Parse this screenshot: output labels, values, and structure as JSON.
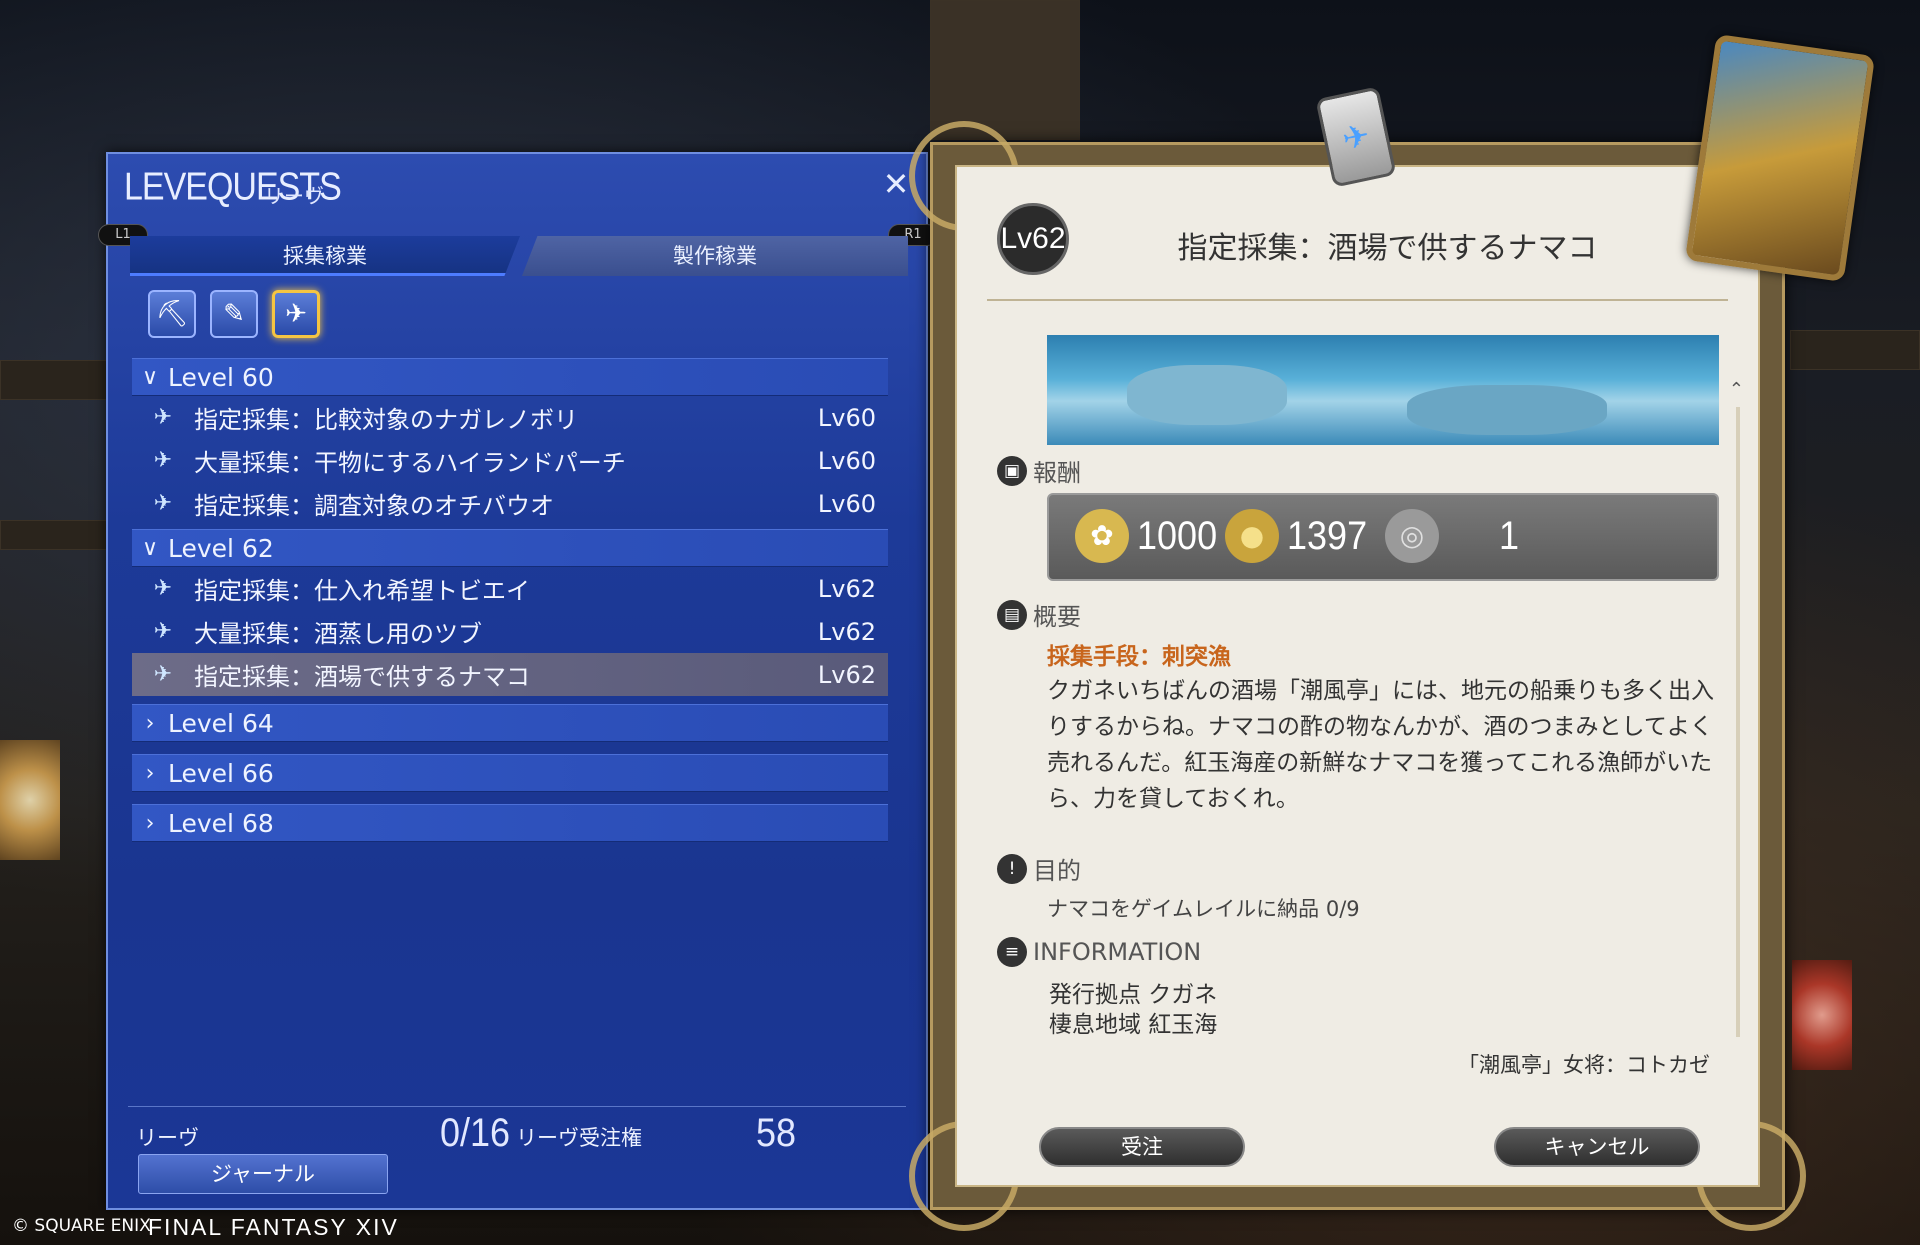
{
  "window": {
    "title": "LEVEQUESTS",
    "subtitle": "リーヴ",
    "close_icon": "close-icon",
    "pad_left": "L1",
    "pad_right": "R1"
  },
  "tabs": [
    {
      "label": "採集稼業",
      "active": true
    },
    {
      "label": "製作稼業",
      "active": false
    }
  ],
  "class_icons": [
    {
      "name": "pickaxe-icon",
      "glyph": "⛏",
      "selected": false
    },
    {
      "name": "sickle-icon",
      "glyph": "✎",
      "selected": false
    },
    {
      "name": "fish-icon",
      "glyph": "✈",
      "selected": true
    }
  ],
  "groups": [
    {
      "label": "Level 60",
      "expanded": true,
      "items": [
        {
          "name": "指定採集：比較対象のナガレノボリ",
          "level": "Lv60",
          "selected": false
        },
        {
          "name": "大量採集：干物にするハイランドパーチ",
          "level": "Lv60",
          "selected": false
        },
        {
          "name": "指定採集：調査対象のオチバウオ",
          "level": "Lv60",
          "selected": false
        }
      ]
    },
    {
      "label": "Level 62",
      "expanded": true,
      "items": [
        {
          "name": "指定採集：仕入れ希望トビエイ",
          "level": "Lv62",
          "selected": false
        },
        {
          "name": "大量採集：酒蒸し用のツブ",
          "level": "Lv62",
          "selected": false
        },
        {
          "name": "指定採集：酒場で供するナマコ",
          "level": "Lv62",
          "selected": true
        }
      ]
    },
    {
      "label": "Level 64",
      "expanded": false,
      "items": []
    },
    {
      "label": "Level 66",
      "expanded": false,
      "items": []
    },
    {
      "label": "Level 68",
      "expanded": false,
      "items": []
    }
  ],
  "footer": {
    "leve_label": "リーヴ",
    "leve_count": "0/16",
    "allowance_label": "リーヴ受注権",
    "allowance_value": "58",
    "journal_button": "ジャーナル"
  },
  "detail": {
    "level_badge": "Lv62",
    "title": "指定採集：酒場で供するナマコ",
    "reward_heading": "報酬",
    "rewards": [
      {
        "icon": "exp-icon",
        "glyph": "✿",
        "value": "1000",
        "color": "#d8b850"
      },
      {
        "icon": "gil-icon",
        "glyph": "●",
        "value": "1397",
        "color": "#c9a43c"
      },
      {
        "icon": "seal-icon",
        "glyph": "◎",
        "value": "1",
        "color": "#9a9a9a"
      }
    ],
    "summary_heading": "概要",
    "method": "採集手段：刺突漁",
    "description": "クガネいちばんの酒場「潮風亭」には、地元の船乗りも多く出入りするからね。ナマコの酢の物なんかが、酒のつまみとしてよく売れるんだ。紅玉海産の新鮮なナマコを獲ってこれる漁師がいたら、力を貸しておくれ。",
    "objective_heading": "目的",
    "objective": "ナマコをゲイムレイルに納品 0/9",
    "info_heading": "INFORMATION",
    "info_lines": [
      "発行拠点 クガネ",
      "棲息地域 紅玉海"
    ],
    "issuer": "「潮風亭」女将：コトカゼ",
    "accept_button": "受注",
    "cancel_button": "キャンセル"
  },
  "branding": {
    "copyright": "© SQUARE ENIX",
    "logo": "FINAL FANTASY XIV"
  }
}
